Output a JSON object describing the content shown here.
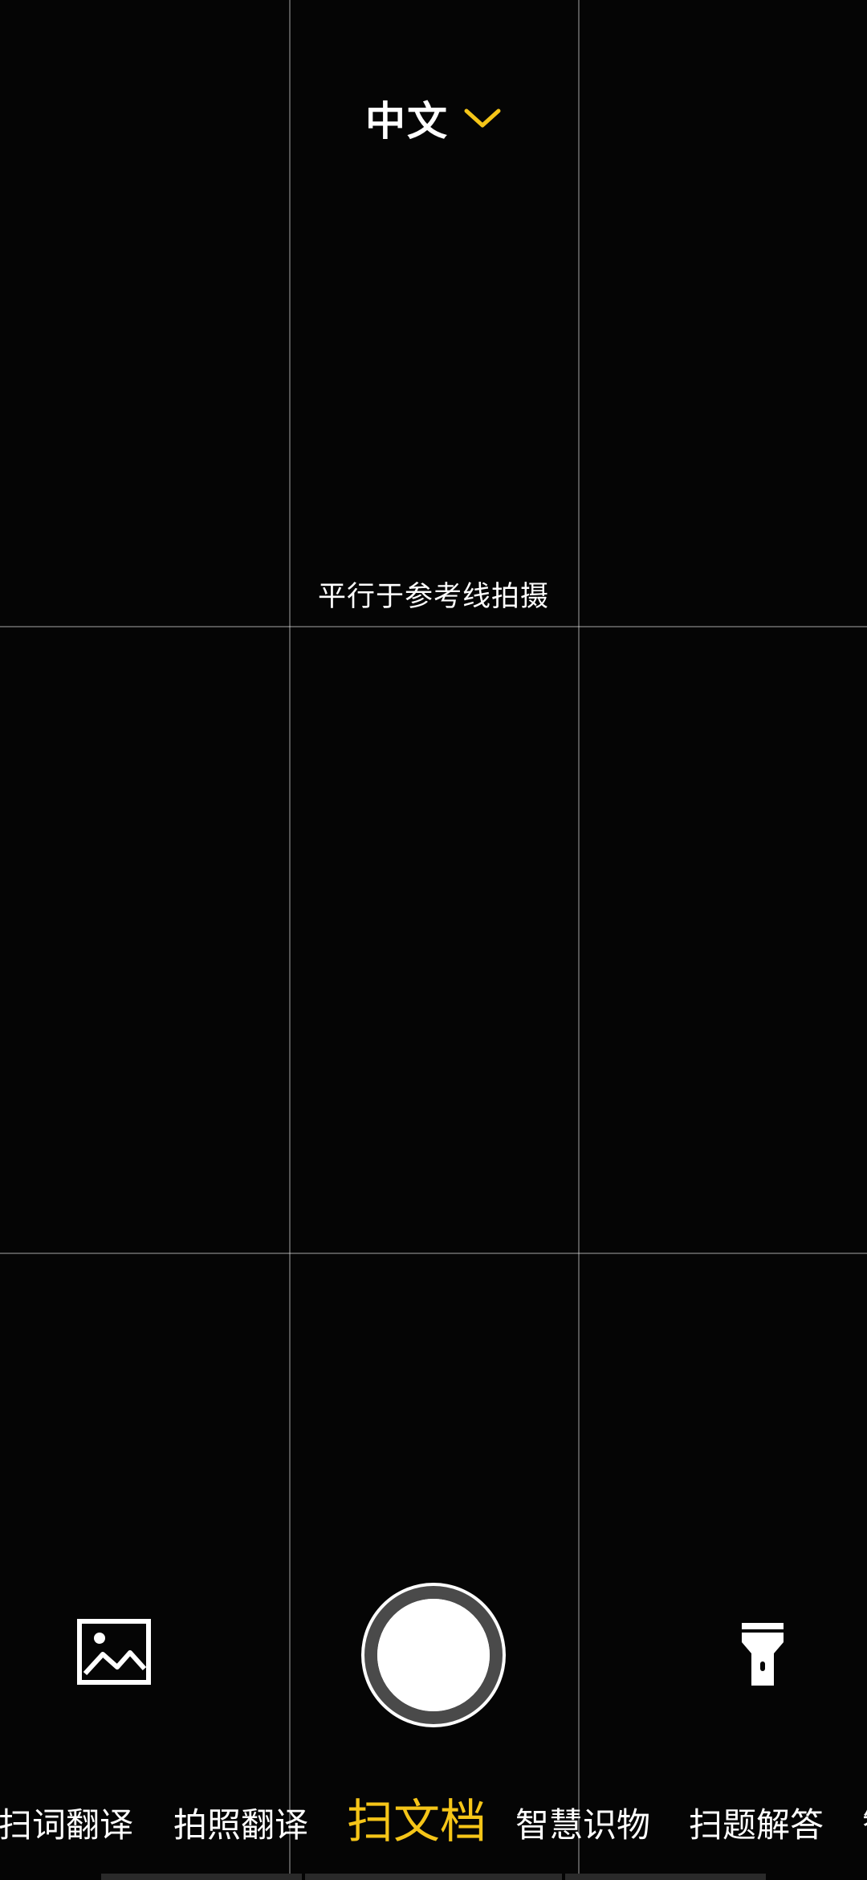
{
  "language_selector": {
    "label": "中文",
    "chevron_icon": "chevron-down-icon",
    "accent_color": "#f5c518"
  },
  "hint_text": "平行于参考线拍摄",
  "controls": {
    "gallery_icon": "image-icon",
    "shutter_icon": "shutter-button",
    "flash_icon": "flashlight-icon"
  },
  "mode_tabs": [
    {
      "label": "扫词翻译",
      "active": false
    },
    {
      "label": "拍照翻译",
      "active": false
    },
    {
      "label": "扫文档",
      "active": true
    },
    {
      "label": "智慧识物",
      "active": false
    },
    {
      "label": "扫题解答",
      "active": false
    },
    {
      "label": "智",
      "active": false
    }
  ],
  "colors": {
    "background": "#050505",
    "active_tab": "#f5c518",
    "text": "#ffffff"
  }
}
